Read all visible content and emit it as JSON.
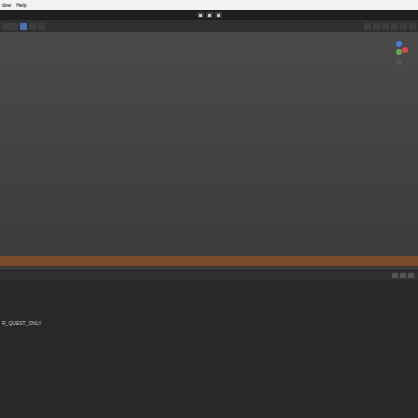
{
  "menu": [
    "dow",
    "Help"
  ],
  "outliner": {
    "items": [
      "R_QUEST_ONLY"
    ]
  }
}
